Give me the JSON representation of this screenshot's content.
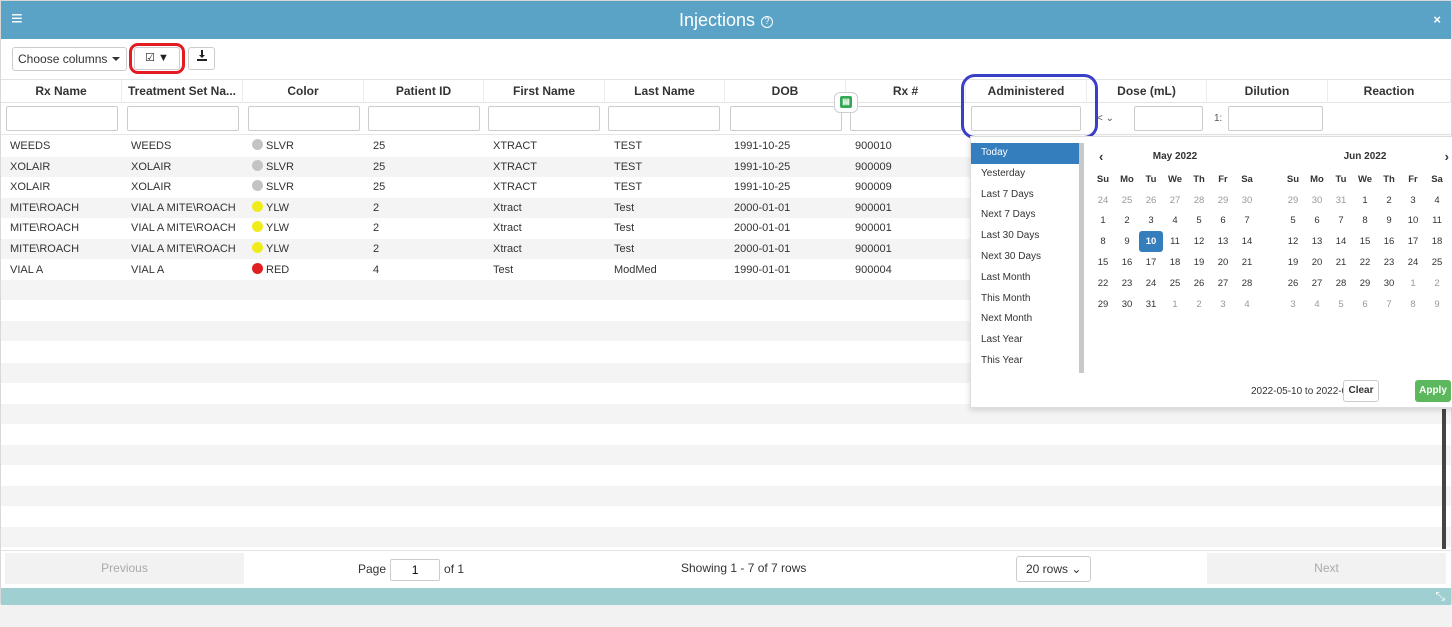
{
  "header": {
    "title": "Injections",
    "help_icon": "question-icon",
    "menu_icon": "hamburger-icon",
    "close_label": "×"
  },
  "toolbar": {
    "choose_columns": "Choose columns",
    "filter_button": "☑ ▼",
    "download_icon": "download-icon"
  },
  "columns": [
    "Rx Name",
    "Treatment Set Na...",
    "Color",
    "Patient ID",
    "First Name",
    "Last Name",
    "DOB",
    "Rx #",
    "Administered",
    "Dose (mL)",
    "Dilution",
    "Reaction"
  ],
  "filters": {
    "dose_operator": "<",
    "dilution_prefix": "1:"
  },
  "rows": [
    {
      "rx": "WEEDS",
      "set": "WEEDS",
      "color": "SLVR",
      "dot": "#c4c4c4",
      "pid": "25",
      "first": "XTRACT",
      "last": "TEST",
      "dob": "1991-10-25",
      "rxno": "900010"
    },
    {
      "rx": "XOLAIR",
      "set": "XOLAIR",
      "color": "SLVR",
      "dot": "#c4c4c4",
      "pid": "25",
      "first": "XTRACT",
      "last": "TEST",
      "dob": "1991-10-25",
      "rxno": "900009"
    },
    {
      "rx": "XOLAIR",
      "set": "XOLAIR",
      "color": "SLVR",
      "dot": "#c4c4c4",
      "pid": "25",
      "first": "XTRACT",
      "last": "TEST",
      "dob": "1991-10-25",
      "rxno": "900009"
    },
    {
      "rx": "MITE\\ROACH",
      "set": "VIAL A MITE\\ROACH",
      "color": "YLW",
      "dot": "#f0ec1c",
      "pid": "2",
      "first": "Xtract",
      "last": "Test",
      "dob": "2000-01-01",
      "rxno": "900001"
    },
    {
      "rx": "MITE\\ROACH",
      "set": "VIAL A MITE\\ROACH",
      "color": "YLW",
      "dot": "#f0ec1c",
      "pid": "2",
      "first": "Xtract",
      "last": "Test",
      "dob": "2000-01-01",
      "rxno": "900001"
    },
    {
      "rx": "MITE\\ROACH",
      "set": "VIAL A MITE\\ROACH",
      "color": "YLW",
      "dot": "#f0ec1c",
      "pid": "2",
      "first": "Xtract",
      "last": "Test",
      "dob": "2000-01-01",
      "rxno": "900001"
    },
    {
      "rx": "VIAL A",
      "set": "VIAL A",
      "color": "RED",
      "dot": "#e02020",
      "pid": "4",
      "first": "Test",
      "last": "ModMed",
      "dob": "1990-01-01",
      "rxno": "900004"
    }
  ],
  "pager": {
    "previous": "Previous",
    "page_label": "Page",
    "page_value": "1",
    "of_label": "of 1",
    "showing": "Showing 1 - 7 of 7 rows",
    "rows_select": "20 rows",
    "next": "Next"
  },
  "daterange": {
    "ranges": [
      "Today",
      "Yesterday",
      "Last 7 Days",
      "Next 7 Days",
      "Last 30 Days",
      "Next 30 Days",
      "Last Month",
      "This Month",
      "Next Month",
      "Last Year",
      "This Year"
    ],
    "active_range": "Today",
    "weekdays": [
      "Su",
      "Mo",
      "Tu",
      "We",
      "Th",
      "Fr",
      "Sa"
    ],
    "left": {
      "month": "May 2022",
      "prev_label": "‹",
      "weeks": [
        [
          "24",
          "25",
          "26",
          "27",
          "28",
          "29",
          "30"
        ],
        [
          "1",
          "2",
          "3",
          "4",
          "5",
          "6",
          "7"
        ],
        [
          "8",
          "9",
          "10",
          "11",
          "12",
          "13",
          "14"
        ],
        [
          "15",
          "16",
          "17",
          "18",
          "19",
          "20",
          "21"
        ],
        [
          "22",
          "23",
          "24",
          "25",
          "26",
          "27",
          "28"
        ],
        [
          "29",
          "30",
          "31",
          "1",
          "2",
          "3",
          "4"
        ]
      ],
      "off_first_week": true,
      "off_last_days": 4,
      "selected": "10"
    },
    "right": {
      "month": "Jun 2022",
      "next_label": "›",
      "weeks": [
        [
          "29",
          "30",
          "31",
          "1",
          "2",
          "3",
          "4"
        ],
        [
          "5",
          "6",
          "7",
          "8",
          "9",
          "10",
          "11"
        ],
        [
          "12",
          "13",
          "14",
          "15",
          "16",
          "17",
          "18"
        ],
        [
          "19",
          "20",
          "21",
          "22",
          "23",
          "24",
          "25"
        ],
        [
          "26",
          "27",
          "28",
          "29",
          "30",
          "1",
          "2"
        ],
        [
          "3",
          "4",
          "5",
          "6",
          "7",
          "8",
          "9"
        ]
      ]
    },
    "range_text": "2022-05-10 to 2022-05-10",
    "clear": "Clear",
    "apply": "Apply"
  }
}
